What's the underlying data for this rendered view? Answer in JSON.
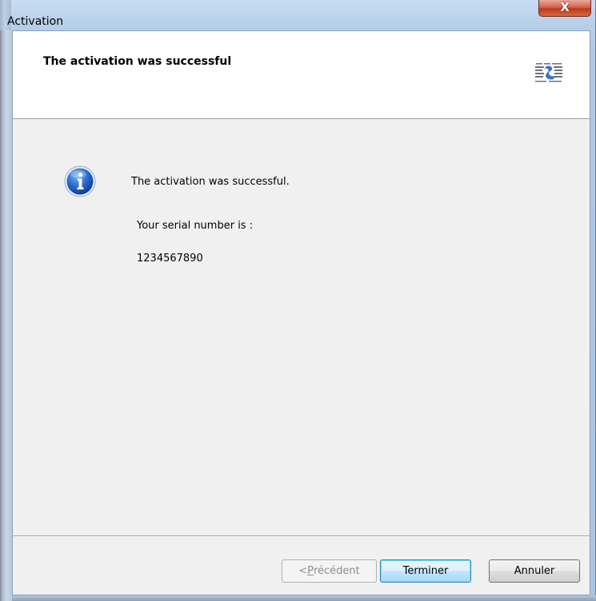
{
  "window": {
    "title": "Activation",
    "close_glyph": "X"
  },
  "header": {
    "title": "The activation was successful",
    "logo_icon": "company-logo-icon"
  },
  "body": {
    "icon": "info-icon",
    "message": "The activation was successful.",
    "serial_label": "Your serial number is :",
    "serial_value": "1234567890"
  },
  "buttons": {
    "previous_prefix": "< ",
    "previous_mnemonic": "P",
    "previous_rest": "récédent",
    "finish": "Terminer",
    "cancel": "Annuler"
  },
  "colors": {
    "title_bar": "#b9d1ea",
    "close_button": "#c7432a",
    "client_bg": "#f0f0f0",
    "info_icon": "#1e5fb4"
  }
}
